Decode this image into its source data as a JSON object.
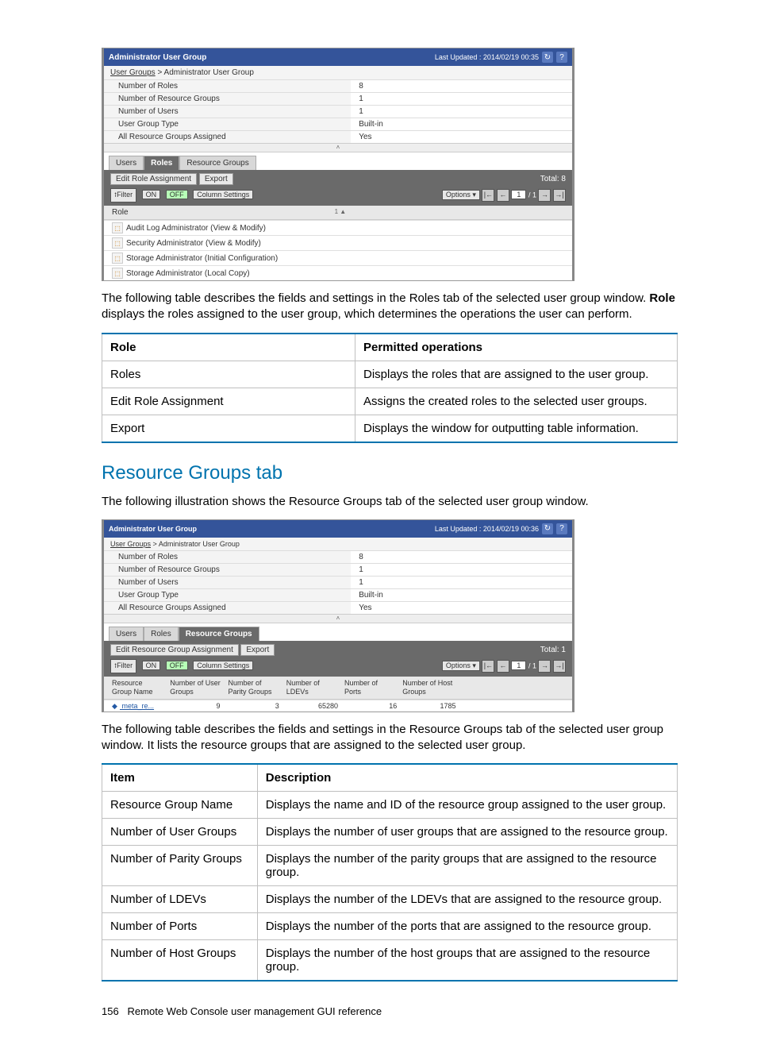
{
  "scr1": {
    "title": "Administrator User Group",
    "updated": "Last Updated : 2014/02/19 00:35",
    "crumb_root": "User Groups",
    "crumb_sep": ">",
    "crumb_leaf": "Administrator User Group",
    "summary": [
      {
        "k": "Number of Roles",
        "v": "8"
      },
      {
        "k": "Number of Resource Groups",
        "v": "1"
      },
      {
        "k": "Number of Users",
        "v": "1"
      },
      {
        "k": "User Group Type",
        "v": "Built-in"
      },
      {
        "k": "All Resource Groups Assigned",
        "v": "Yes"
      }
    ],
    "tabs": {
      "a": "Users",
      "b": "Roles",
      "c": "Resource Groups"
    },
    "btn_edit": "Edit Role Assignment",
    "btn_export": "Export",
    "total": "Total:  8",
    "filter": "⭫Filter",
    "on": "ON",
    "off": "OFF",
    "colset": "Column Settings",
    "options": "Options ▾",
    "page": "1",
    "pages": "/ 1",
    "head_role": "Role",
    "sort": "1 ▲",
    "rows": [
      "Audit Log Administrator (View & Modify)",
      "Security Administrator (View & Modify)",
      "Storage Administrator (Initial Configuration)",
      "Storage Administrator (Local Copy)"
    ]
  },
  "para1_a": "The following table describes the fields and settings in the Roles tab of the selected user group window. ",
  "para1_b": "Role",
  "para1_c": " displays the roles assigned to the user group, which determines the operations the user can perform.",
  "table1": {
    "h1": "Role",
    "h2": "Permitted operations",
    "rows": [
      {
        "a": "Roles",
        "b": "Displays the roles that are assigned to the user group."
      },
      {
        "a": "Edit Role Assignment",
        "b": "Assigns the created roles to the selected user groups."
      },
      {
        "a": "Export",
        "b": "Displays the window for outputting table information."
      }
    ]
  },
  "section": "Resource Groups tab",
  "para2": "The following illustration shows the Resource Groups tab of the selected user group window.",
  "scr2": {
    "title": "Administrator User Group",
    "updated": "Last Updated : 2014/02/19 00:36",
    "crumb_root": "User Groups",
    "crumb_sep": ">",
    "crumb_leaf": "Administrator User Group",
    "summary": [
      {
        "k": "Number of Roles",
        "v": "8"
      },
      {
        "k": "Number of Resource Groups",
        "v": "1"
      },
      {
        "k": "Number of Users",
        "v": "1"
      },
      {
        "k": "User Group Type",
        "v": "Built-in"
      },
      {
        "k": "All Resource Groups Assigned",
        "v": "Yes"
      }
    ],
    "tabs": {
      "a": "Users",
      "b": "Roles",
      "c": "Resource Groups"
    },
    "btn_edit": "Edit Resource Group Assignment",
    "btn_export": "Export",
    "total": "Total:  1",
    "filter": "⭫Filter",
    "on": "ON",
    "off": "OFF",
    "colset": "Column Settings",
    "options": "Options ▾",
    "page": "1",
    "pages": "/ 1",
    "headers": [
      "Resource Group Name",
      "Number of User Groups",
      "Number of Parity Groups",
      "Number of LDEVs",
      "Number of Ports",
      "Number of Host Groups"
    ],
    "row": {
      "name": "meta_re...",
      "ug": "9",
      "pg": "3",
      "ldev": "65280",
      "ports": "16",
      "hg": "1785"
    }
  },
  "para3": "The following table describes the fields and settings in the Resource Groups tab of the selected user group window. It lists the resource groups that are assigned to the selected user group.",
  "table2": {
    "h1": "Item",
    "h2": "Description",
    "rows": [
      {
        "a": "Resource Group Name",
        "b": "Displays the name and ID of the resource group assigned to the user group."
      },
      {
        "a": "Number of User Groups",
        "b": "Displays the number of user groups that are assigned to the resource group."
      },
      {
        "a": "Number of Parity Groups",
        "b": "Displays the number of the parity groups that are assigned to the resource group."
      },
      {
        "a": "Number of LDEVs",
        "b": "Displays the number of the LDEVs that are assigned to the resource group."
      },
      {
        "a": "Number of Ports",
        "b": "Displays the number of the ports that are assigned to the resource group."
      },
      {
        "a": "Number of Host Groups",
        "b": "Displays the number of the host groups that are assigned to the resource group."
      }
    ]
  },
  "footer_page": "156",
  "footer_text": "Remote Web Console user management GUI reference"
}
